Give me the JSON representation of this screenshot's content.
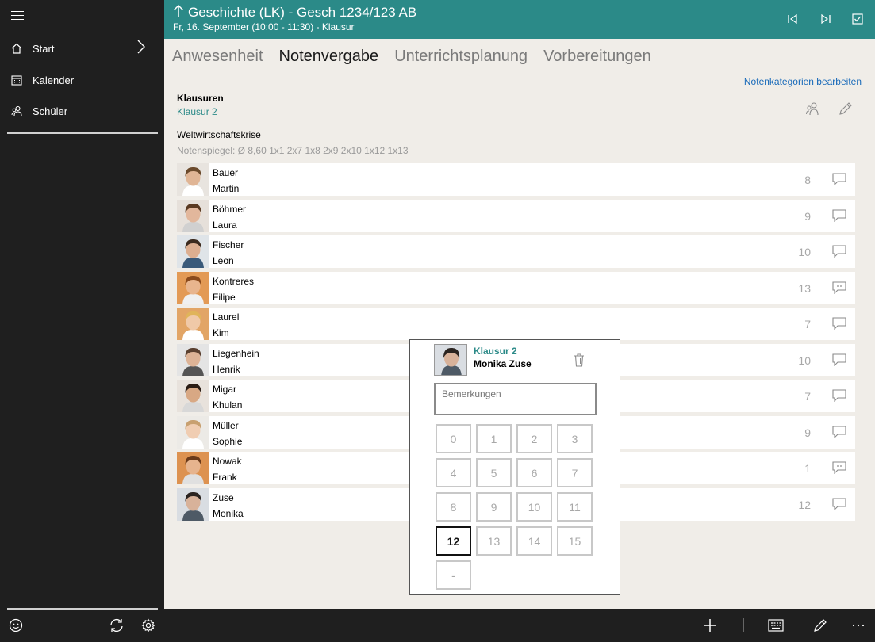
{
  "sidebar": {
    "items": [
      {
        "label": "Start",
        "icon": "home-icon"
      },
      {
        "label": "Kalender",
        "icon": "calendar-icon"
      },
      {
        "label": "Schüler",
        "icon": "people-icon"
      }
    ],
    "bottom_icons": [
      "smiley-icon",
      "sync-icon",
      "gear-icon"
    ]
  },
  "header": {
    "title": "Geschichte (LK) - Gesch 1234/123 AB",
    "subtitle": "Fr, 16. September (10:00 - 11:30) - Klausur",
    "bg_color": "#2b8a88"
  },
  "tabs": [
    {
      "label": "Anwesenheit",
      "active": false
    },
    {
      "label": "Notenvergabe",
      "active": true
    },
    {
      "label": "Unterrichtsplanung",
      "active": false
    },
    {
      "label": "Vorbereitungen",
      "active": false
    }
  ],
  "main": {
    "edit_link": "Notenkategorien bearbeiten",
    "section_title": "Klausuren",
    "section_sub": "Klausur 2",
    "topic": "Weltwirtschaftskrise",
    "notenspiegel": "Notenspiegel: Ø 8,60   1x1   2x7   1x8   2x9   2x10   1x12   1x13"
  },
  "students": [
    {
      "last": "Bauer",
      "first": "Martin",
      "grade": "8",
      "has_comment": false
    },
    {
      "last": "Böhmer",
      "first": "Laura",
      "grade": "9",
      "has_comment": false
    },
    {
      "last": "Fischer",
      "first": "Leon",
      "grade": "10",
      "has_comment": false
    },
    {
      "last": "Kontreres",
      "first": "Filipe",
      "grade": "13",
      "has_comment": true
    },
    {
      "last": "Laurel",
      "first": "Kim",
      "grade": "7",
      "has_comment": false
    },
    {
      "last": "Liegenhein",
      "first": "Henrik",
      "grade": "10",
      "has_comment": false
    },
    {
      "last": "Migar",
      "first": "Khulan",
      "grade": "7",
      "has_comment": false
    },
    {
      "last": "Müller",
      "first": "Sophie",
      "grade": "9",
      "has_comment": false
    },
    {
      "last": "Nowak",
      "first": "Frank",
      "grade": "1",
      "has_comment": true
    },
    {
      "last": "Zuse",
      "first": "Monika",
      "grade": "12",
      "has_comment": false
    }
  ],
  "popup": {
    "title": "Klausur 2",
    "name": "Monika Zuse",
    "remarks_placeholder": "Bemerkungen",
    "keys": [
      "0",
      "1",
      "2",
      "3",
      "4",
      "5",
      "6",
      "7",
      "8",
      "9",
      "10",
      "11",
      "12",
      "13",
      "14",
      "15",
      "-"
    ],
    "selected": "12"
  },
  "bottombar": {
    "icons": [
      "add-icon",
      "keyboard-icon",
      "pencil-icon",
      "more-icon"
    ]
  }
}
